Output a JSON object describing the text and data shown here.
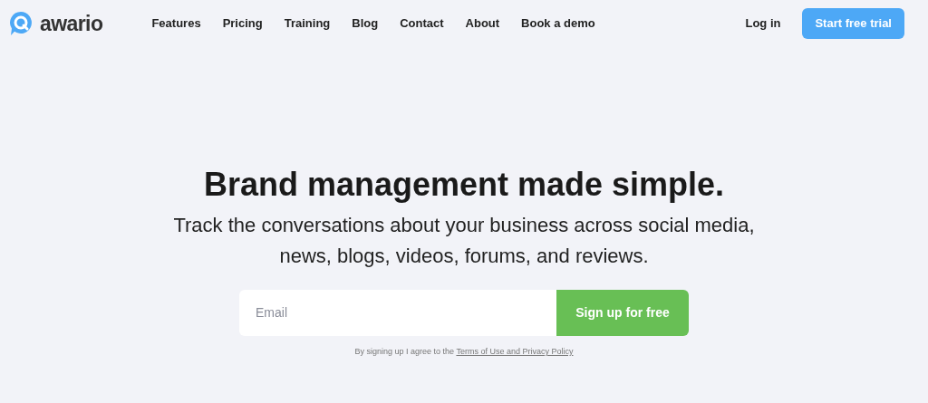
{
  "header": {
    "logo": "awario",
    "nav": [
      "Features",
      "Pricing",
      "Training",
      "Blog",
      "Contact",
      "About",
      "Book a demo"
    ],
    "login": "Log in",
    "cta": "Start free trial"
  },
  "hero": {
    "title": "Brand management made simple.",
    "subtitle": "Track the conversations about your business across social media, news, blogs, videos, forums, and reviews.",
    "email_placeholder": "Email",
    "signup": "Sign up for free",
    "consent": "By signing up I agree to the ",
    "consent_link": "Terms of Use and Privacy Policy"
  }
}
